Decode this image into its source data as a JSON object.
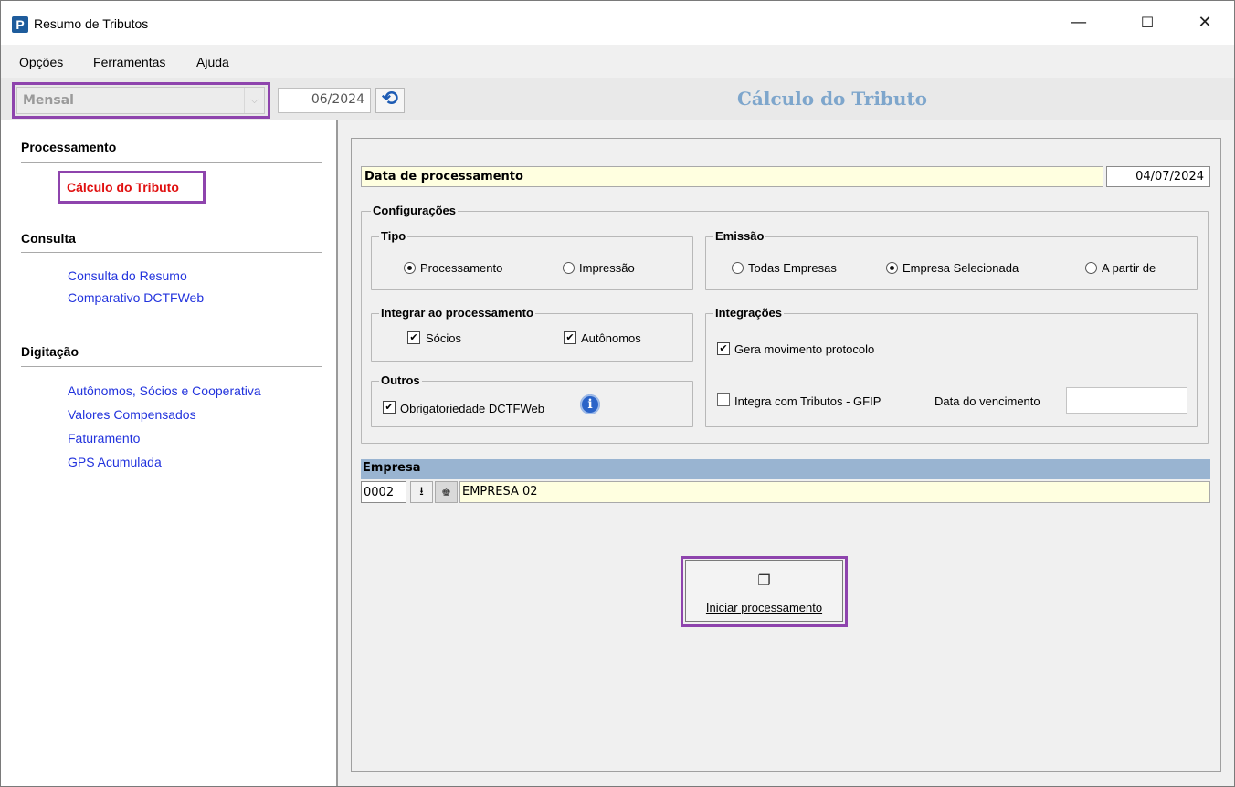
{
  "window": {
    "title": "Resumo de Tributos",
    "app_icon": "P",
    "controls": {
      "minimize": "—",
      "maximize": "☐",
      "close": "✕"
    }
  },
  "menu": [
    {
      "label": "Opções",
      "underline": "O",
      "rest": "pções"
    },
    {
      "label": "Ferramentas",
      "underline": "F",
      "rest": "erramentas"
    },
    {
      "label": "Ajuda",
      "underline": "A",
      "rest": "juda"
    }
  ],
  "toolbar": {
    "period": "Mensal",
    "month": "06/2024",
    "refresh_icon": "undo-icon"
  },
  "page_title": "Cálculo do Tributo",
  "sidebar": {
    "sections": [
      {
        "title": "Processamento",
        "items": [
          "Cálculo do Tributo"
        ]
      },
      {
        "title": "Consulta",
        "items": [
          "Consulta do Resumo",
          "Comparativo DCTFWeb"
        ]
      },
      {
        "title": "Digitação",
        "items": [
          "Autônomos, Sócios e Cooperativa",
          "Valores Compensados",
          "Faturamento",
          "GPS Acumulada"
        ]
      }
    ],
    "active": "Cálculo do Tributo"
  },
  "form": {
    "data_processamento_label": "Data de processamento",
    "data_processamento": "04/07/2024",
    "configuracoes_title": "Configurações",
    "tipo": {
      "title": "Tipo",
      "options": [
        "Processamento",
        "Impressão"
      ],
      "selected": "Processamento"
    },
    "emissao": {
      "title": "Emissão",
      "options": [
        "Todas Empresas",
        "Empresa Selecionada",
        "A partir de"
      ],
      "selected": "Empresa Selecionada"
    },
    "integrar": {
      "title": "Integrar ao processamento",
      "socios": {
        "label": "Sócios",
        "checked": true
      },
      "autonomos": {
        "label": "Autônomos",
        "checked": true
      }
    },
    "integracoes": {
      "title": "Integrações",
      "gera_movimento": {
        "label": "Gera movimento protocolo",
        "checked": true
      },
      "integra_gfip": {
        "label": "Integra com Tributos - GFIP",
        "checked": false
      },
      "data_vencimento_label": "Data do vencimento",
      "data_vencimento": ""
    },
    "outros": {
      "title": "Outros",
      "obrigatoriedade": {
        "label": "Obrigatoriedade DCTFWeb",
        "checked": true
      },
      "info_icon": "i"
    },
    "empresa": {
      "title": "Empresa",
      "code": "0002",
      "name": "EMPRESA 02"
    },
    "start_button": "Iniciar processamento"
  },
  "colors": {
    "highlight": "#8e44ad",
    "active_link": "#e01010",
    "link": "#2233dd",
    "page_title": "#7ea6cc",
    "empresa_header": "#99b4d1",
    "field_yellow": "#ffffe0"
  }
}
